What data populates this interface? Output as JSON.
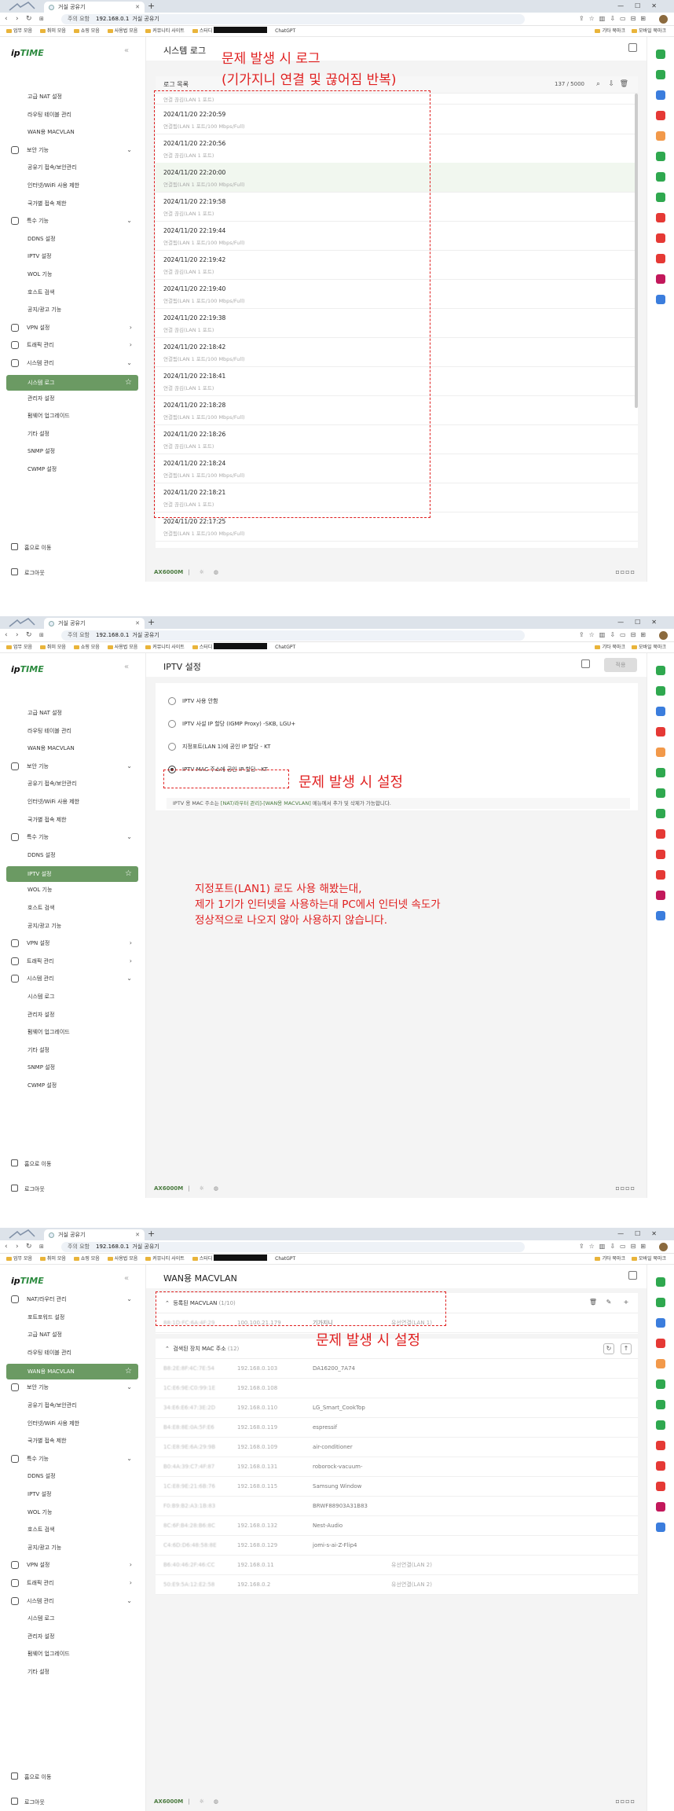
{
  "browser": {
    "tab_title": "거실 공유기",
    "url_warning": "주의 요함",
    "url_host": "192.168.0.1",
    "url_path": "거실 공유기",
    "bookmarks": [
      "업무 모음",
      "취미 모음",
      "쇼핑 모음",
      "사용법 모음",
      "커뮤니티 사이트",
      "스터디"
    ],
    "bookmark_chatgpt": "ChatGPT",
    "bookmarks_right": [
      "기타 북마크",
      "모바일 북마크"
    ]
  },
  "router": {
    "logo_ip": "ip",
    "logo_time": "TIME",
    "model": "AX6000M",
    "footer_sep": "|",
    "menu_home": "홈으로 이동",
    "menu_logout": "로그아웃"
  },
  "menus": {
    "s1": [
      {
        "label": "고급 NAT 설정",
        "kind": "sub"
      },
      {
        "label": "라우팅 테이블 관리",
        "kind": "sub"
      },
      {
        "label": "WAN용 MACVLAN",
        "kind": "sub"
      },
      {
        "label": "보안 기능",
        "kind": "top",
        "chev": "⌄"
      },
      {
        "label": "공유기 접속/보안관리",
        "kind": "sub"
      },
      {
        "label": "인터넷/WiFi 사용 제한",
        "kind": "sub"
      },
      {
        "label": "국가별 접속 제한",
        "kind": "sub"
      },
      {
        "label": "특수 기능",
        "kind": "top",
        "chev": "⌄"
      },
      {
        "label": "DDNS 설정",
        "kind": "sub"
      },
      {
        "label": "IPTV 설정",
        "kind": "sub"
      },
      {
        "label": "WOL 기능",
        "kind": "sub"
      },
      {
        "label": "호스트 검색",
        "kind": "sub"
      },
      {
        "label": "공지/광고 기능",
        "kind": "sub"
      },
      {
        "label": "VPN 설정",
        "kind": "top",
        "chev": "›"
      },
      {
        "label": "트래픽 관리",
        "kind": "top",
        "chev": "›"
      },
      {
        "label": "시스템 관리",
        "kind": "top",
        "chev": "⌄"
      },
      {
        "label": "시스템 로그",
        "kind": "active"
      },
      {
        "label": "관리자 설정",
        "kind": "sub"
      },
      {
        "label": "펌웨어 업그레이드",
        "kind": "sub"
      },
      {
        "label": "기타 설정",
        "kind": "sub"
      },
      {
        "label": "SNMP 설정",
        "kind": "sub"
      },
      {
        "label": "CWMP 설정",
        "kind": "sub"
      }
    ],
    "s2": [
      {
        "label": "고급 NAT 설정",
        "kind": "sub"
      },
      {
        "label": "라우팅 테이블 관리",
        "kind": "sub"
      },
      {
        "label": "WAN용 MACVLAN",
        "kind": "sub"
      },
      {
        "label": "보안 기능",
        "kind": "top",
        "chev": "⌄"
      },
      {
        "label": "공유기 접속/보안관리",
        "kind": "sub"
      },
      {
        "label": "인터넷/WiFi 사용 제한",
        "kind": "sub"
      },
      {
        "label": "국가별 접속 제한",
        "kind": "sub"
      },
      {
        "label": "특수 기능",
        "kind": "top",
        "chev": "⌄"
      },
      {
        "label": "DDNS 설정",
        "kind": "sub"
      },
      {
        "label": "IPTV 설정",
        "kind": "active"
      },
      {
        "label": "WOL 기능",
        "kind": "sub"
      },
      {
        "label": "호스트 검색",
        "kind": "sub"
      },
      {
        "label": "공지/광고 기능",
        "kind": "sub"
      },
      {
        "label": "VPN 설정",
        "kind": "top",
        "chev": "›"
      },
      {
        "label": "트래픽 관리",
        "kind": "top",
        "chev": "›"
      },
      {
        "label": "시스템 관리",
        "kind": "top",
        "chev": "⌄"
      },
      {
        "label": "시스템 로그",
        "kind": "sub"
      },
      {
        "label": "관리자 설정",
        "kind": "sub"
      },
      {
        "label": "펌웨어 업그레이드",
        "kind": "sub"
      },
      {
        "label": "기타 설정",
        "kind": "sub"
      },
      {
        "label": "SNMP 설정",
        "kind": "sub"
      },
      {
        "label": "CWMP 설정",
        "kind": "sub"
      }
    ],
    "s3": [
      {
        "label": "NAT/라우터 관리",
        "kind": "top",
        "chev": "⌄"
      },
      {
        "label": "포트포워드 설정",
        "kind": "sub"
      },
      {
        "label": "고급 NAT 설정",
        "kind": "sub"
      },
      {
        "label": "라우팅 테이블 관리",
        "kind": "sub"
      },
      {
        "label": "WAN용 MACVLAN",
        "kind": "active"
      },
      {
        "label": "보안 기능",
        "kind": "top",
        "chev": "⌄"
      },
      {
        "label": "공유기 접속/보안관리",
        "kind": "sub"
      },
      {
        "label": "인터넷/WiFi 사용 제한",
        "kind": "sub"
      },
      {
        "label": "국가별 접속 제한",
        "kind": "sub"
      },
      {
        "label": "특수 기능",
        "kind": "top",
        "chev": "⌄"
      },
      {
        "label": "DDNS 설정",
        "kind": "sub"
      },
      {
        "label": "IPTV 설정",
        "kind": "sub"
      },
      {
        "label": "WOL 기능",
        "kind": "sub"
      },
      {
        "label": "호스트 검색",
        "kind": "sub"
      },
      {
        "label": "공지/광고 기능",
        "kind": "sub"
      },
      {
        "label": "VPN 설정",
        "kind": "top",
        "chev": "›"
      },
      {
        "label": "트래픽 관리",
        "kind": "top",
        "chev": "›"
      },
      {
        "label": "시스템 관리",
        "kind": "top",
        "chev": "⌄"
      },
      {
        "label": "시스템 로그",
        "kind": "sub"
      },
      {
        "label": "관리자 설정",
        "kind": "sub"
      },
      {
        "label": "펌웨어 업그레이드",
        "kind": "sub"
      },
      {
        "label": "기타 설정",
        "kind": "sub"
      }
    ]
  },
  "syslog": {
    "page_title": "시스템 로그",
    "list_title": "로그 목록",
    "count": "137 / 5000",
    "annotation_line1": "문제 발생 시 로그",
    "annotation_line2": "(기가지니 연결 및 끊어짐 반복)",
    "entries": [
      {
        "ts": "",
        "msg": "연결 끊김(LAN 1 포트)"
      },
      {
        "ts": "2024/11/20  22:20:59",
        "msg": "연결됨(LAN 1 포트/100 Mbps/Full)"
      },
      {
        "ts": "2024/11/20  22:20:56",
        "msg": "연결 끊김(LAN 1 포트)"
      },
      {
        "ts": "2024/11/20  22:20:00",
        "msg": "연결됨(LAN 1 포트/100 Mbps/Full)"
      },
      {
        "ts": "2024/11/20  22:19:58",
        "msg": "연결 끊김(LAN 1 포트)"
      },
      {
        "ts": "2024/11/20  22:19:44",
        "msg": "연결됨(LAN 1 포트/100 Mbps/Full)"
      },
      {
        "ts": "2024/11/20  22:19:42",
        "msg": "연결 끊김(LAN 1 포트)"
      },
      {
        "ts": "2024/11/20  22:19:40",
        "msg": "연결됨(LAN 1 포트/100 Mbps/Full)"
      },
      {
        "ts": "2024/11/20  22:19:38",
        "msg": "연결 끊김(LAN 1 포트)"
      },
      {
        "ts": "2024/11/20  22:18:42",
        "msg": "연결됨(LAN 1 포트/100 Mbps/Full)"
      },
      {
        "ts": "2024/11/20  22:18:41",
        "msg": "연결 끊김(LAN 1 포트)"
      },
      {
        "ts": "2024/11/20  22:18:28",
        "msg": "연결됨(LAN 1 포트/100 Mbps/Full)"
      },
      {
        "ts": "2024/11/20  22:18:26",
        "msg": "연결 끊김(LAN 1 포트)"
      },
      {
        "ts": "2024/11/20  22:18:24",
        "msg": "연결됨(LAN 1 포트/100 Mbps/Full)"
      },
      {
        "ts": "2024/11/20  22:18:21",
        "msg": "연결 끊김(LAN 1 포트)"
      },
      {
        "ts": "2024/11/20  22:17:25",
        "msg": "연결됨(LAN 1 포트/100 Mbps/Full)"
      }
    ]
  },
  "iptv": {
    "page_title": "IPTV 설정",
    "apply": "적용",
    "options": [
      "IPTV 사용 안함",
      "IPTV 사설 IP 할당 (IGMP Proxy) -SKB, LGU+",
      "지정포트(LAN 1)에 공인 IP 할당 - KT",
      "IPTV MAC 주소에 공인 IP 할당 - KT"
    ],
    "selected_index": 3,
    "note_pre": "IPTV 용 MAC 주소는 ",
    "note_link": "[NAT/라우터 관리]-[WAN용 MACVLAN]",
    "note_post": " 메뉴에서 추가 및 삭제가 가능합니다.",
    "annotation": "문제 발생 시 설정",
    "comment_lines": [
      "지정포트(LAN1) 로도 사용 해봤는대,",
      "제가 1기가 인터넷을 사용하는대 PC에서 인터넷 속도가",
      "정상적으로 나오지 않아 사용하지 않습니다."
    ]
  },
  "macvlan": {
    "page_title": "WAN용 MACVLAN",
    "registered_title": "등록된 MACVLAN",
    "registered_count": "(1/10)",
    "registered": [
      {
        "mac": "88:1D:FC:6A:4F:29",
        "ip": "100.100.21.179",
        "name": "기가지니",
        "conn": "유선연결(LAN 1)"
      }
    ],
    "detected_title": "검색된 장치 MAC 주소",
    "detected_count": "(12)",
    "annotation": "문제 발생 시 설정",
    "detected": [
      {
        "mac": "B8:2E:8F:4C:7E:54",
        "ip": "192.168.0.103",
        "name": "DA16200_7A74",
        "conn": ""
      },
      {
        "mac": "1C:E6:9E:C0:99:1E",
        "ip": "192.168.0.108",
        "name": "",
        "conn": ""
      },
      {
        "mac": "34:E6:E6:47:3E:2D",
        "ip": "192.168.0.110",
        "name": "LG_Smart_CookTop",
        "conn": ""
      },
      {
        "mac": "B4:E8:8E:0A:5F:E6",
        "ip": "192.168.0.119",
        "name": "espressif",
        "conn": ""
      },
      {
        "mac": "1C:E8:9E:6A:29:9B",
        "ip": "192.168.0.109",
        "name": "air-conditioner",
        "conn": ""
      },
      {
        "mac": "B0:4A:39:C7:4F:87",
        "ip": "192.168.0.131",
        "name": "roborock-vacuum-",
        "conn": ""
      },
      {
        "mac": "1C:E8:9E:21:6B:76",
        "ip": "192.168.0.115",
        "name": "Samsung Window",
        "conn": ""
      },
      {
        "mac": "F0:B9:B2:A3:1B:83",
        "ip": "",
        "name": "BRWF88903A31B83",
        "conn": ""
      },
      {
        "mac": "8C:6F:B4:28:B6:8C",
        "ip": "192.168.0.132",
        "name": "Nest-Audio",
        "conn": ""
      },
      {
        "mac": "C4:6D:D6:48:58:8E",
        "ip": "192.168.0.129",
        "name": "jomi-s-ai-Z-Flip4",
        "conn": ""
      },
      {
        "mac": "B6:40:46:2F:46:CC",
        "ip": "192.168.0.11",
        "name": "",
        "conn": "유선연결(LAN 2)"
      },
      {
        "mac": "50:E9:5A:12:E2:58",
        "ip": "192.168.0.2",
        "name": "",
        "conn": "유선연결(LAN 2)"
      }
    ]
  },
  "colors": {
    "accent_green": "#6b9a63",
    "annotation_red": "#e02020"
  },
  "icons": [
    "back-icon",
    "forward-icon",
    "reload-icon",
    "star-icon",
    "home-icon",
    "logout-icon",
    "sun-icon",
    "globe-icon",
    "search-icon",
    "download-icon",
    "trash-icon",
    "refresh-icon",
    "upload-icon",
    "edit-icon",
    "plus-icon"
  ]
}
